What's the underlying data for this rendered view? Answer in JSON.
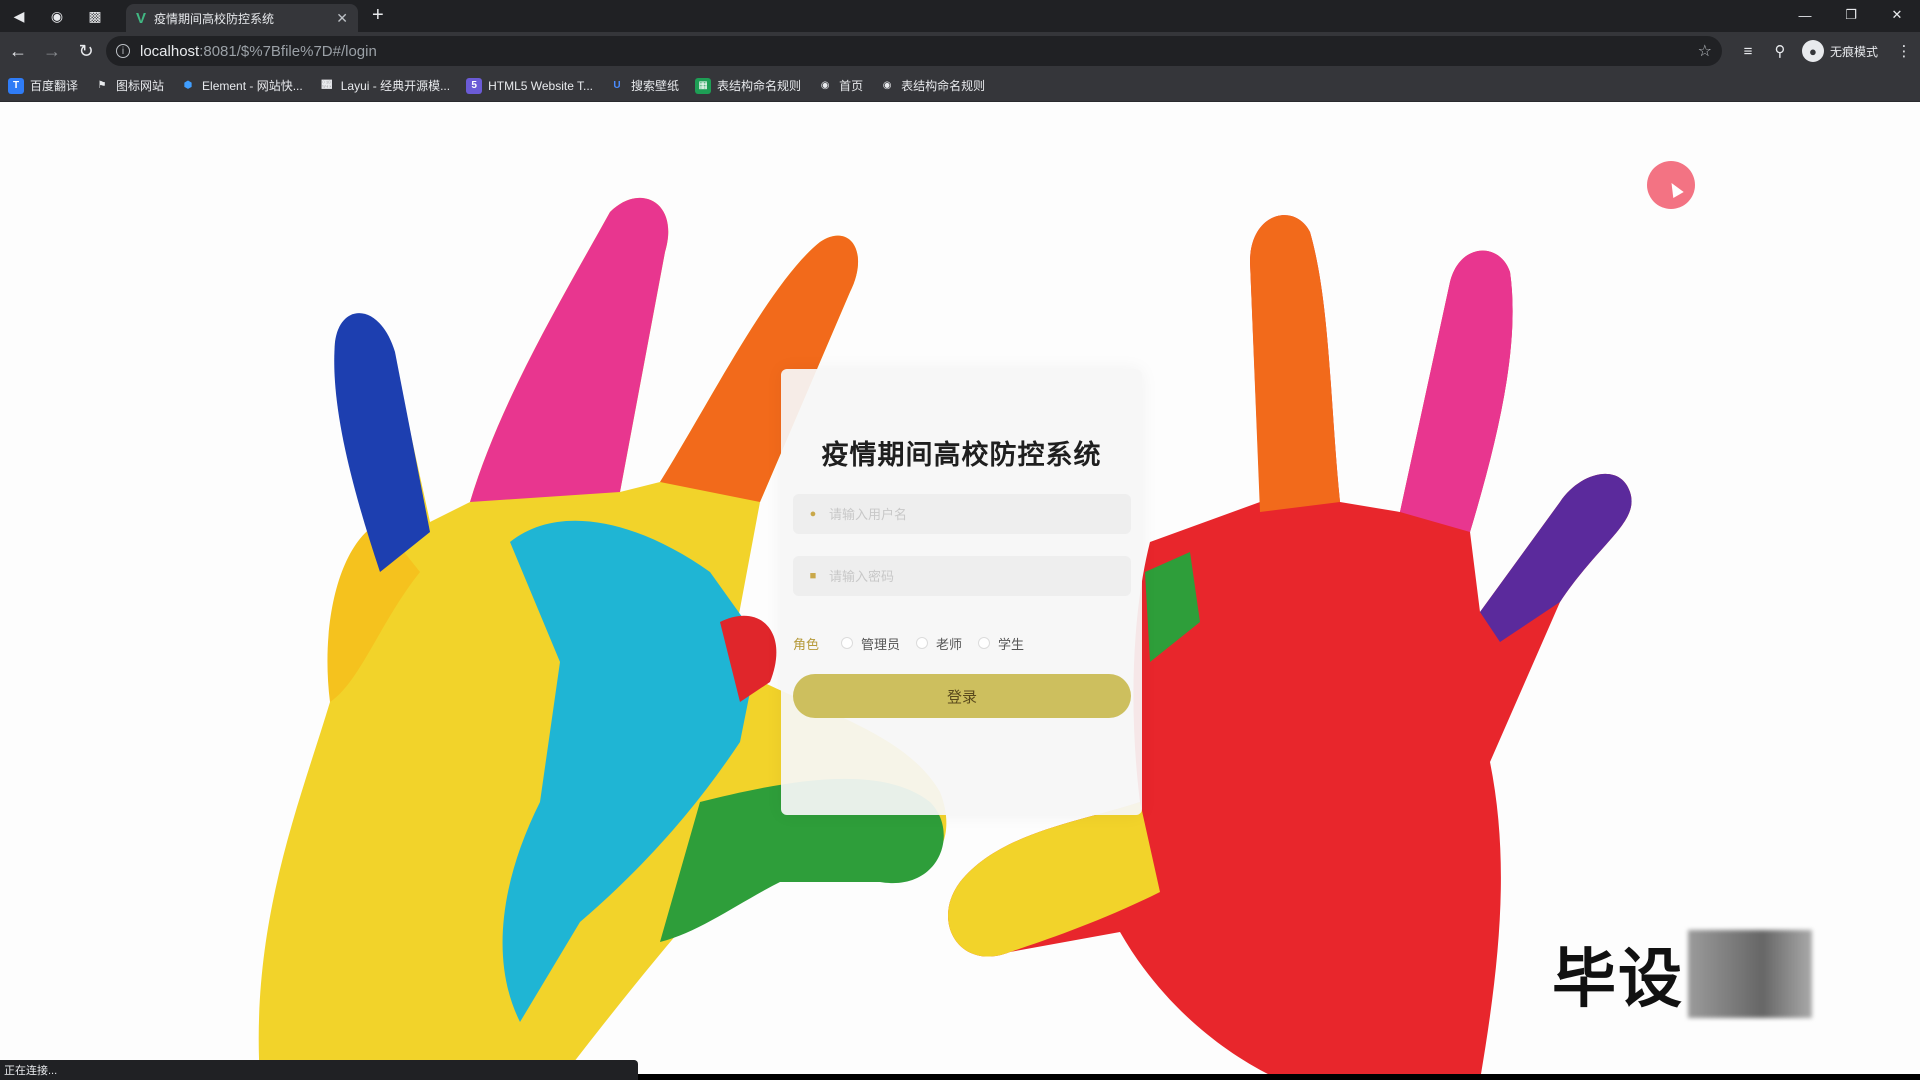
{
  "browser": {
    "tab_title": "疫情期间高校防控系统",
    "address_host": "localhost",
    "address_path": ":8081/$%7Bfile%7D#/login",
    "incognito_label": "无痕模式",
    "status_text": "正在连接..."
  },
  "bookmarks": [
    {
      "label": "百度翻译",
      "icon": "baidu-translate-icon",
      "color": "#2f7cf6"
    },
    {
      "label": "图标网站",
      "icon": "flag-icon",
      "color": "#444"
    },
    {
      "label": "Element - 网站快...",
      "icon": "element-icon",
      "color": "#409eff"
    },
    {
      "label": "Layui - 经典开源模...",
      "icon": "layui-icon",
      "color": "#555"
    },
    {
      "label": "HTML5 Website T...",
      "icon": "html5-icon",
      "color": "#6b5bd6"
    },
    {
      "label": "搜索壁纸",
      "icon": "wallpaper-icon",
      "color": "#2a6fdb"
    },
    {
      "label": "表结构命名规则",
      "icon": "sheet-icon",
      "color": "#1e9e55"
    },
    {
      "label": "首页",
      "icon": "globe-icon",
      "color": "#555"
    },
    {
      "label": "表结构命名规则",
      "icon": "globe-icon",
      "color": "#555"
    }
  ],
  "login": {
    "title": "疫情期间高校防控系统",
    "username_placeholder": "请输入用户名",
    "password_placeholder": "请输入密码",
    "role_label": "角色",
    "roles": [
      "管理员",
      "老师",
      "学生"
    ],
    "submit_label": "登录"
  },
  "watermark": {
    "text": "毕设"
  },
  "colors": {
    "accent_gold": "#cdbf5e",
    "role_label": "#b69a3a",
    "cursor_highlight": "#f05064"
  }
}
